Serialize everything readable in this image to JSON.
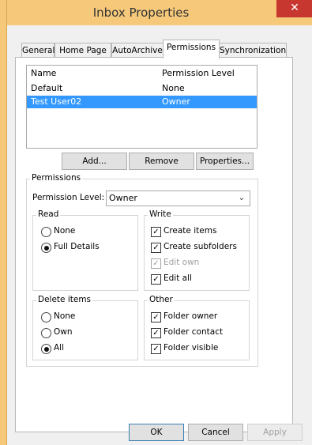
{
  "window": {
    "title": "Inbox Properties",
    "close_glyph": "✕"
  },
  "tabs": [
    {
      "label": "General"
    },
    {
      "label": "Home Page"
    },
    {
      "label": "AutoArchive"
    },
    {
      "label": "Permissions"
    },
    {
      "label": "Synchronization"
    }
  ],
  "list": {
    "headers": {
      "name": "Name",
      "level": "Permission Level"
    },
    "rows": [
      {
        "name": "Default",
        "level": "None",
        "selected": false
      },
      {
        "name": "Test User02",
        "level": "Owner",
        "selected": true
      }
    ]
  },
  "actions": {
    "add": "Add...",
    "remove": "Remove",
    "properties": "Properties..."
  },
  "permissions": {
    "group_label": "Permissions",
    "level_label": "Permission Level:",
    "level_value": "Owner",
    "read": {
      "label": "Read",
      "options": [
        {
          "label": "None",
          "selected": false
        },
        {
          "label": "Full Details",
          "selected": true
        }
      ]
    },
    "write": {
      "label": "Write",
      "options": [
        {
          "label": "Create items",
          "checked": true,
          "disabled": false
        },
        {
          "label": "Create subfolders",
          "checked": true,
          "disabled": false
        },
        {
          "label": "Edit own",
          "checked": true,
          "disabled": true
        },
        {
          "label": "Edit all",
          "checked": true,
          "disabled": false
        }
      ]
    },
    "delete": {
      "label": "Delete items",
      "options": [
        {
          "label": "None",
          "selected": false
        },
        {
          "label": "Own",
          "selected": false
        },
        {
          "label": "All",
          "selected": true
        }
      ]
    },
    "other": {
      "label": "Other",
      "options": [
        {
          "label": "Folder owner",
          "checked": true
        },
        {
          "label": "Folder contact",
          "checked": true
        },
        {
          "label": "Folder visible",
          "checked": true
        }
      ]
    }
  },
  "footer": {
    "ok": "OK",
    "cancel": "Cancel",
    "apply": "Apply"
  },
  "colors": {
    "titlebar": "#f5c87a",
    "selection": "#3399ff",
    "close": "#c7372f"
  }
}
